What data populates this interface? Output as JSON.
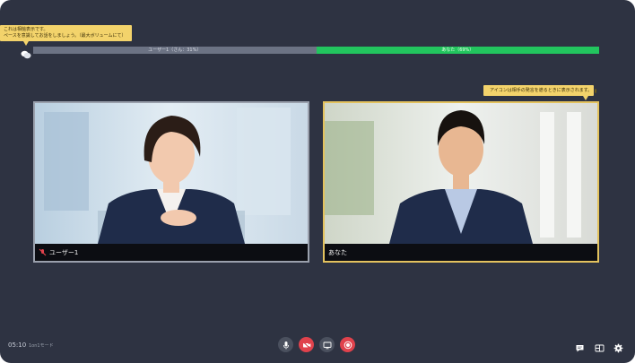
{
  "tips": {
    "top_line1": "これは相槌表示です。",
    "top_line2": "ペースを意識してお話をしましょう。（最大ボリュームにて）",
    "right": "アイコンは相手の発言を遮るときに表示されます。"
  },
  "ratio": {
    "user_label": "ユーザー1（さん：31%）",
    "you_label": "あなた（69%）",
    "user_percent": 31,
    "you_percent": 69
  },
  "participants": [
    {
      "name": "ユーザー1",
      "muted": true
    },
    {
      "name": "あなた",
      "muted": false
    }
  ],
  "footer": {
    "time": "05:10",
    "mode": "1on1モード"
  },
  "colors": {
    "background": "#2e3342",
    "accent_green": "#22c55e",
    "tooltip_yellow": "#f3d36b",
    "danger_red": "#e0424c"
  }
}
